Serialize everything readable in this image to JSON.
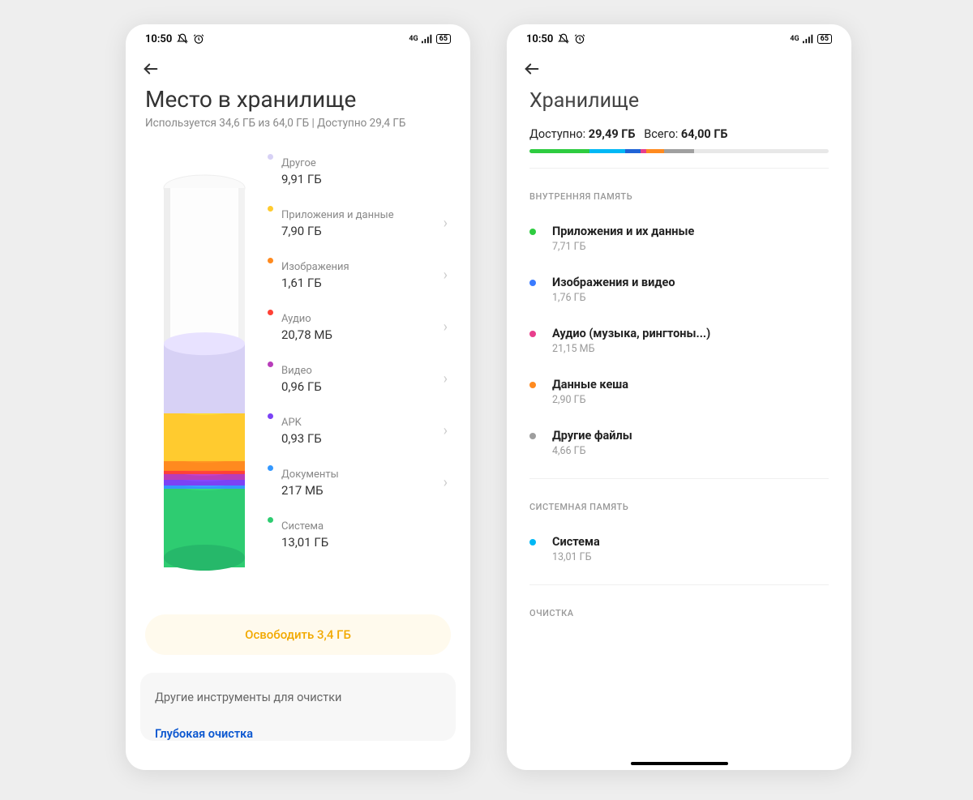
{
  "status": {
    "time": "10:50",
    "battery": "65"
  },
  "phone1": {
    "title": "Место в хранилище",
    "subtitle": "Используется 34,6 ГБ из 64,0 ГБ | Доступно 29,4 ГБ",
    "items": [
      {
        "label": "Другое",
        "value": "9,91 ГБ",
        "color": "#d7d1f5",
        "chev": false
      },
      {
        "label": "Приложения и данные",
        "value": "7,90 ГБ",
        "color": "#ffcb2f",
        "chev": true
      },
      {
        "label": "Изображения",
        "value": "1,61 ГБ",
        "color": "#ff8a1f",
        "chev": true
      },
      {
        "label": "Аудио",
        "value": "20,78 МБ",
        "color": "#ff4136",
        "chev": true
      },
      {
        "label": "Видео",
        "value": "0,96 ГБ",
        "color": "#b83dba",
        "chev": true
      },
      {
        "label": "APK",
        "value": "0,93 ГБ",
        "color": "#7b42f6",
        "chev": true
      },
      {
        "label": "Документы",
        "value": "217 МБ",
        "color": "#3498ff",
        "chev": true
      },
      {
        "label": "Система",
        "value": "13,01 ГБ",
        "color": "#2ecc71",
        "chev": false
      }
    ],
    "free_button": "Освободить 3,4 ГБ",
    "tools_title": "Другие инструменты для очистки",
    "deep_clean": "Глубокая очистка"
  },
  "phone2": {
    "title": "Хранилище",
    "avail_label": "Доступно:",
    "avail_value": "29,49 ГБ",
    "total_label": "Всего:",
    "total_value": "64,00 ГБ",
    "bar": [
      {
        "color": "#2ecc40",
        "pct": 20
      },
      {
        "color": "#00b8f5",
        "pct": 12
      },
      {
        "color": "#2063d6",
        "pct": 5
      },
      {
        "color": "#e83e8c",
        "pct": 2
      },
      {
        "color": "#ff8a1f",
        "pct": 6
      },
      {
        "color": "#a0a0a0",
        "pct": 10
      }
    ],
    "sect_internal": "ВНУТРЕННЯЯ ПАМЯТЬ",
    "internal": [
      {
        "label": "Приложения и их данные",
        "value": "7,71 ГБ",
        "color": "#2ecc40"
      },
      {
        "label": "Изображения и видео",
        "value": "1,76 ГБ",
        "color": "#3a7bff"
      },
      {
        "label": "Аудио (музыка, рингтоны...)",
        "value": "21,15 МБ",
        "color": "#e83e8c"
      },
      {
        "label": "Данные кеша",
        "value": "2,90 ГБ",
        "color": "#ff8a1f"
      },
      {
        "label": "Другие файлы",
        "value": "4,66 ГБ",
        "color": "#9e9e9e"
      }
    ],
    "sect_system": "СИСТЕМНАЯ ПАМЯТЬ",
    "system": [
      {
        "label": "Система",
        "value": "13,01 ГБ",
        "color": "#00b8f5"
      }
    ],
    "sect_clean": "ОЧИСТКА"
  },
  "chart_data": {
    "type": "bar",
    "title": "Storage usage breakdown (cylinder chart)",
    "total_gb": 64.0,
    "used_gb": 34.6,
    "available_gb": 29.4,
    "categories": [
      "Другое",
      "Приложения и данные",
      "Изображения",
      "Аудио",
      "Видео",
      "APK",
      "Документы",
      "Система"
    ],
    "values_gb": [
      9.91,
      7.9,
      1.61,
      0.02,
      0.96,
      0.93,
      0.21,
      13.01
    ]
  }
}
